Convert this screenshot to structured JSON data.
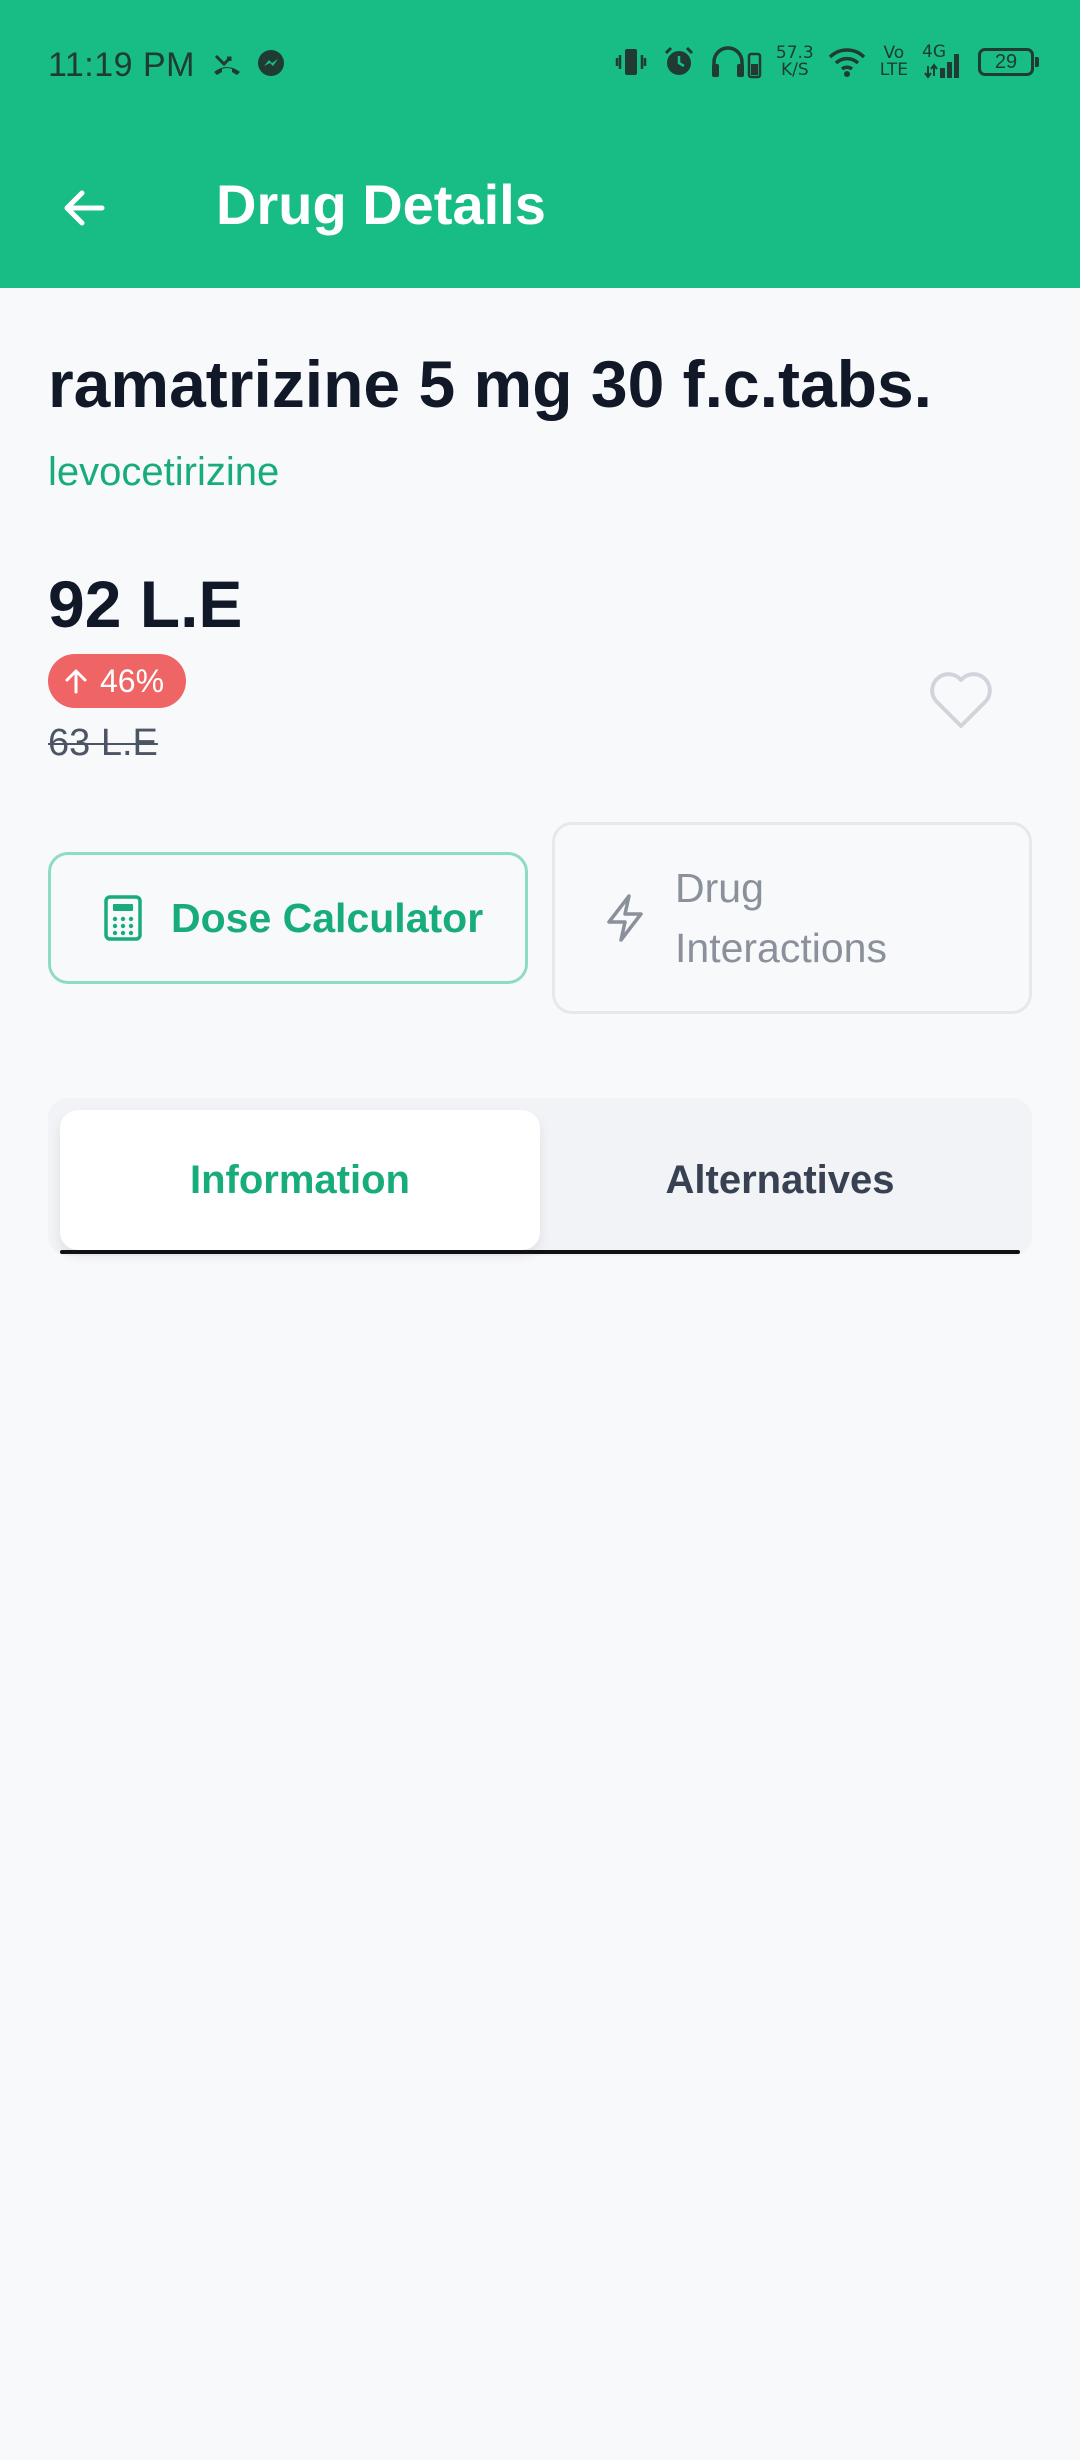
{
  "status_bar": {
    "time": "11:19 PM",
    "net_speed_value": "57.3",
    "net_speed_unit": "K/S",
    "volte_top": "Vo",
    "volte_bottom": "LTE",
    "network_type": "4G",
    "battery_level": "29"
  },
  "app_bar": {
    "title": "Drug Details"
  },
  "drug": {
    "name": "ramatrizine 5 mg 30 f.c.tabs.",
    "generic": "levocetirizine",
    "price": "92 L.E",
    "change_percent": "46%",
    "old_price": "63 L.E"
  },
  "actions": {
    "dose_calculator": "Dose Calculator",
    "interactions_line1": "Drug",
    "interactions_line2": "Interactions"
  },
  "tabs": {
    "information": "Information",
    "alternatives": "Alternatives"
  },
  "colors": {
    "brand": "#18bc85",
    "accent_text": "#18ac7c",
    "badge_red": "#ef6464",
    "background": "#f8f9fb"
  }
}
